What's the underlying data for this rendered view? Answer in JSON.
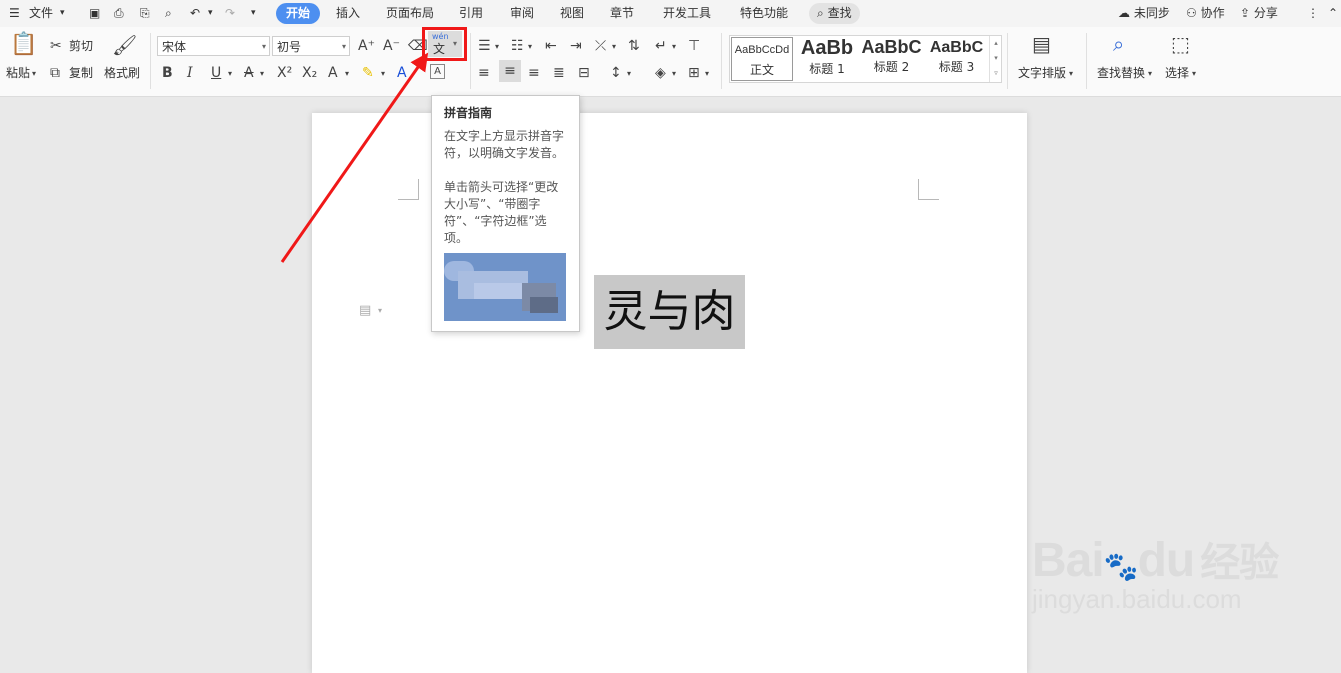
{
  "menubar": {
    "file": "文件",
    "tabs": [
      "开始",
      "插入",
      "页面布局",
      "引用",
      "审阅",
      "视图",
      "章节",
      "开发工具",
      "特色功能"
    ],
    "search": "查找",
    "sync": "未同步",
    "collab": "协作",
    "share": "分享"
  },
  "ribbon": {
    "paste": "粘贴",
    "cut": "剪切",
    "copy": "复制",
    "format_painter": "格式刷",
    "font_name": "宋体",
    "font_size": "初号",
    "pinyin_glyph_top": "wén",
    "pinyin_glyph_bottom": "文",
    "styles": [
      {
        "sample": "AaBbCcDd",
        "name": "正文"
      },
      {
        "sample": "AaBb",
        "name": "标题 1"
      },
      {
        "sample": "AaBbC",
        "name": "标题 2"
      },
      {
        "sample": "AaBbC",
        "name": "标题 3"
      }
    ],
    "text_layout": "文字排版",
    "find_replace": "查找替换",
    "select": "选择"
  },
  "tooltip": {
    "title": "拼音指南",
    "line1": "在文字上方显示拼音字符，以明确文字发音。",
    "line2": "单击箭头可选择“更改大小写”、“带圈字符”、“字符边框”选项。"
  },
  "document": {
    "text": "灵与肉"
  },
  "watermark": {
    "brand": "Bai",
    "brand2": "du",
    "brand_cn": "经验",
    "url": "jingyan.baidu.com"
  },
  "colors": {
    "accent": "#4d8ff0",
    "highlight_red": "#f01818",
    "selection_gray": "#c8c8c8"
  }
}
